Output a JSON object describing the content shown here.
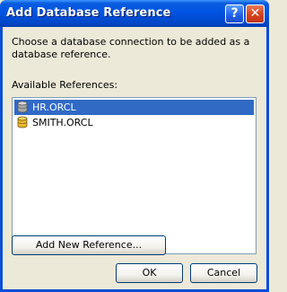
{
  "dialog": {
    "title": "Add Database Reference",
    "help_glyph": "?",
    "close_glyph": "✕"
  },
  "content": {
    "description": "Choose a database connection to be added as a database reference.",
    "available_label": "Available References:",
    "references": [
      {
        "label": "HR.ORCL",
        "icon": "database-icon-gray",
        "selected": true
      },
      {
        "label": "SMITH.ORCL",
        "icon": "database-icon-yellow",
        "selected": false
      }
    ]
  },
  "buttons": {
    "add_new": "Add New Reference...",
    "ok": "OK",
    "cancel": "Cancel"
  },
  "colors": {
    "title_bar": "#0054e3",
    "selection": "#316ac5",
    "dialog_bg": "#ece9d8"
  }
}
